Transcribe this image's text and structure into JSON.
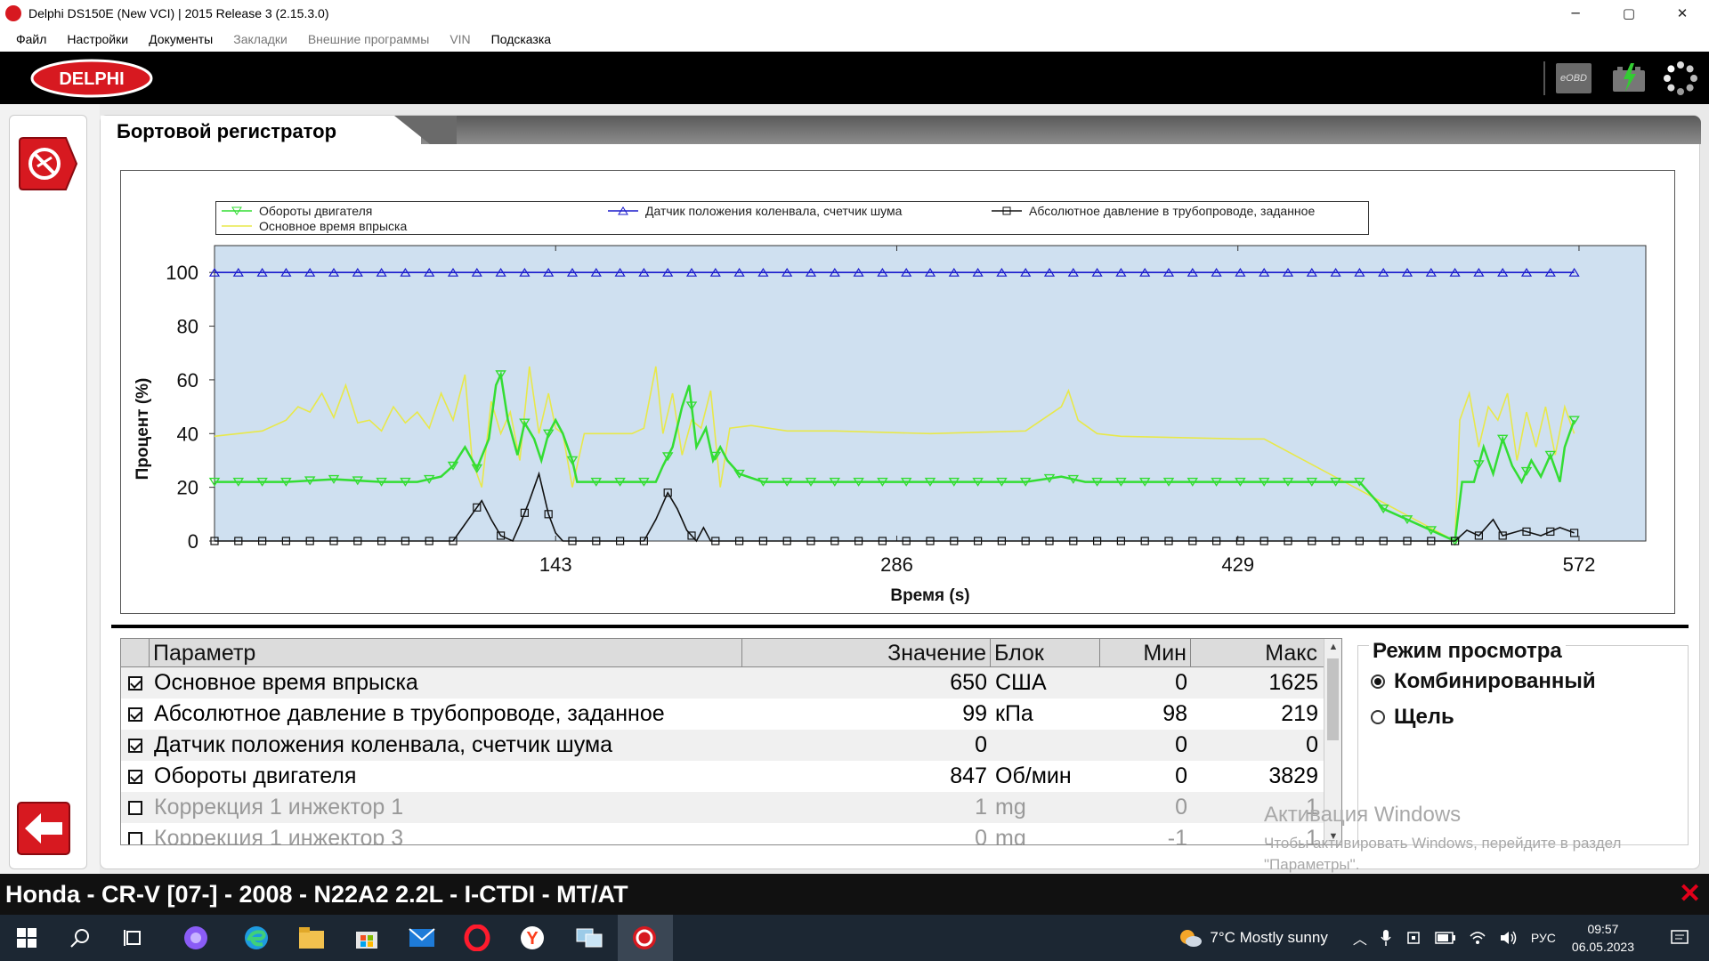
{
  "window": {
    "title": "Delphi DS150E (New VCI) | 2015 Release 3 (2.15.3.0)",
    "controls": {
      "minimize": "─",
      "maximize": "▢",
      "close": "✕"
    }
  },
  "menu": {
    "items": [
      {
        "label": "Файл",
        "enabled": true
      },
      {
        "label": "Настройки",
        "enabled": true
      },
      {
        "label": "Документы",
        "enabled": true
      },
      {
        "label": "Закладки",
        "enabled": false
      },
      {
        "label": "Внешние программы",
        "enabled": false
      },
      {
        "label": "VIN",
        "enabled": false
      },
      {
        "label": "Подсказка",
        "enabled": true
      }
    ]
  },
  "header": {
    "logo_text": "DELPHI",
    "eobd_label": "eOBD",
    "icons": [
      "eobd-icon",
      "battery-icon",
      "loading-spinner-icon"
    ]
  },
  "page": {
    "title": "Бортовой регистратор"
  },
  "chart_data": {
    "type": "line",
    "xlabel": "Время (s)",
    "ylabel": "Процент (%)",
    "xlim": [
      0,
      600
    ],
    "ylim": [
      0,
      100
    ],
    "x_ticks": [
      143,
      286,
      429,
      572
    ],
    "y_ticks": [
      0,
      20,
      40,
      60,
      80,
      100
    ],
    "background": "#cfe0f0",
    "legend_position": "top",
    "series": [
      {
        "name": "Обороты двигателя",
        "color": "#33dd33",
        "marker": "triangle-down",
        "points": [
          [
            0,
            22
          ],
          [
            30,
            22
          ],
          [
            50,
            23
          ],
          [
            70,
            22
          ],
          [
            85,
            22
          ],
          [
            95,
            24
          ],
          [
            100,
            28
          ],
          [
            105,
            35
          ],
          [
            110,
            27
          ],
          [
            115,
            38
          ],
          [
            118,
            58
          ],
          [
            120,
            62
          ],
          [
            123,
            45
          ],
          [
            127,
            32
          ],
          [
            130,
            44
          ],
          [
            134,
            38
          ],
          [
            137,
            30
          ],
          [
            140,
            40
          ],
          [
            143,
            45
          ],
          [
            146,
            40
          ],
          [
            150,
            30
          ],
          [
            152,
            22
          ],
          [
            170,
            22
          ],
          [
            185,
            22
          ],
          [
            188,
            28
          ],
          [
            192,
            35
          ],
          [
            196,
            50
          ],
          [
            199,
            58
          ],
          [
            202,
            35
          ],
          [
            206,
            42
          ],
          [
            209,
            30
          ],
          [
            212,
            35
          ],
          [
            215,
            30
          ],
          [
            220,
            25
          ],
          [
            230,
            22
          ],
          [
            260,
            22
          ],
          [
            300,
            22
          ],
          [
            340,
            22
          ],
          [
            355,
            24
          ],
          [
            365,
            22
          ],
          [
            400,
            22
          ],
          [
            440,
            22
          ],
          [
            470,
            22
          ],
          [
            480,
            22
          ],
          [
            490,
            12
          ],
          [
            520,
            0
          ],
          [
            523,
            22
          ],
          [
            528,
            22
          ],
          [
            532,
            35
          ],
          [
            536,
            25
          ],
          [
            540,
            38
          ],
          [
            544,
            28
          ],
          [
            548,
            22
          ],
          [
            552,
            30
          ],
          [
            556,
            24
          ],
          [
            560,
            32
          ],
          [
            564,
            22
          ],
          [
            566,
            35
          ],
          [
            568,
            40
          ],
          [
            570,
            45
          ]
        ]
      },
      {
        "name": "Основное время впрыска",
        "color": "#e8e84a",
        "marker": "none",
        "points": [
          [
            0,
            39
          ],
          [
            10,
            40
          ],
          [
            20,
            41
          ],
          [
            30,
            45
          ],
          [
            35,
            50
          ],
          [
            40,
            48
          ],
          [
            45,
            55
          ],
          [
            50,
            46
          ],
          [
            55,
            58
          ],
          [
            60,
            44
          ],
          [
            65,
            45
          ],
          [
            70,
            41
          ],
          [
            75,
            50
          ],
          [
            80,
            44
          ],
          [
            85,
            48
          ],
          [
            90,
            42
          ],
          [
            95,
            55
          ],
          [
            100,
            45
          ],
          [
            105,
            62
          ],
          [
            108,
            30
          ],
          [
            112,
            20
          ],
          [
            116,
            52
          ],
          [
            120,
            40
          ],
          [
            124,
            48
          ],
          [
            128,
            30
          ],
          [
            132,
            65
          ],
          [
            136,
            40
          ],
          [
            140,
            55
          ],
          [
            143,
            42
          ],
          [
            146,
            40
          ],
          [
            150,
            20
          ],
          [
            155,
            40
          ],
          [
            165,
            40
          ],
          [
            175,
            40
          ],
          [
            180,
            42
          ],
          [
            185,
            65
          ],
          [
            188,
            40
          ],
          [
            192,
            55
          ],
          [
            196,
            32
          ],
          [
            200,
            45
          ],
          [
            204,
            42
          ],
          [
            208,
            56
          ],
          [
            212,
            20
          ],
          [
            216,
            42
          ],
          [
            225,
            43
          ],
          [
            240,
            41
          ],
          [
            260,
            41
          ],
          [
            300,
            40
          ],
          [
            340,
            41
          ],
          [
            355,
            50
          ],
          [
            358,
            56
          ],
          [
            362,
            45
          ],
          [
            370,
            40
          ],
          [
            380,
            39
          ],
          [
            430,
            38
          ],
          [
            440,
            38
          ],
          [
            520,
            0
          ],
          [
            522,
            45
          ],
          [
            526,
            55
          ],
          [
            530,
            35
          ],
          [
            534,
            50
          ],
          [
            538,
            45
          ],
          [
            542,
            55
          ],
          [
            546,
            30
          ],
          [
            550,
            48
          ],
          [
            554,
            35
          ],
          [
            558,
            50
          ],
          [
            562,
            32
          ],
          [
            566,
            50
          ],
          [
            570,
            40
          ]
        ]
      },
      {
        "name": "Датчик положения коленвала, счетчик шума",
        "color": "#1a1acc",
        "marker": "triangle-up",
        "points": [
          [
            0,
            100
          ],
          [
            570,
            100
          ]
        ]
      },
      {
        "name": "Абсолютное давление в трубопроводе, заданное",
        "color": "#111111",
        "marker": "square",
        "points": [
          [
            0,
            0
          ],
          [
            80,
            0
          ],
          [
            100,
            0
          ],
          [
            104,
            5
          ],
          [
            108,
            10
          ],
          [
            112,
            15
          ],
          [
            116,
            8
          ],
          [
            120,
            2
          ],
          [
            125,
            0
          ],
          [
            128,
            6
          ],
          [
            132,
            15
          ],
          [
            136,
            25
          ],
          [
            140,
            10
          ],
          [
            143,
            3
          ],
          [
            146,
            0
          ],
          [
            180,
            0
          ],
          [
            185,
            8
          ],
          [
            190,
            18
          ],
          [
            194,
            12
          ],
          [
            198,
            4
          ],
          [
            202,
            0
          ],
          [
            205,
            5
          ],
          [
            208,
            0
          ],
          [
            370,
            0
          ],
          [
            400,
            0
          ],
          [
            500,
            0
          ],
          [
            520,
            0
          ],
          [
            525,
            4
          ],
          [
            530,
            2
          ],
          [
            536,
            8
          ],
          [
            540,
            2
          ],
          [
            548,
            4
          ],
          [
            556,
            2
          ],
          [
            564,
            5
          ],
          [
            570,
            3
          ]
        ]
      }
    ]
  },
  "table": {
    "headers": {
      "param": "Параметр",
      "value": "Значение",
      "unit": "Блок",
      "min": "Мин",
      "max": "Макс"
    },
    "rows": [
      {
        "checked": true,
        "param": "Основное время впрыска",
        "value": "650",
        "unit": "США",
        "min": "0",
        "max": "1625"
      },
      {
        "checked": true,
        "param": "Абсолютное давление в трубопроводе, заданное",
        "value": "99",
        "unit": "кПа",
        "min": "98",
        "max": "219"
      },
      {
        "checked": true,
        "param": "Датчик положения коленвала, счетчик шума",
        "value": "0",
        "unit": "",
        "min": "0",
        "max": "0"
      },
      {
        "checked": true,
        "param": "Обороты двигателя",
        "value": "847",
        "unit": "Об/мин",
        "min": "0",
        "max": "3829"
      },
      {
        "checked": false,
        "param": "Коррекция 1 инжектор 1",
        "value": "1",
        "unit": "mg",
        "min": "0",
        "max": "1"
      },
      {
        "checked": false,
        "param": "Коррекция 1 инжектор 3",
        "value": "0",
        "unit": "mg",
        "min": "-1",
        "max": "1"
      }
    ]
  },
  "view_mode": {
    "title": "Режим просмотра",
    "options": [
      {
        "label": "Комбинированный",
        "selected": true
      },
      {
        "label": "Щель",
        "selected": false
      }
    ]
  },
  "watermark": {
    "line1": "Активация Windows",
    "line2": "Чтобы активировать Windows, перейдите в раздел \"Параметры\"."
  },
  "status": {
    "vehicle": "Honda - CR-V [07-] - 2008 - N22A2 2.2L - I-CTDI - MT/AT",
    "close": "✕"
  },
  "taskbar": {
    "weather": "7°C  Mostly sunny",
    "lang": "РУС",
    "time": "09:57",
    "date": "06.05.2023"
  }
}
